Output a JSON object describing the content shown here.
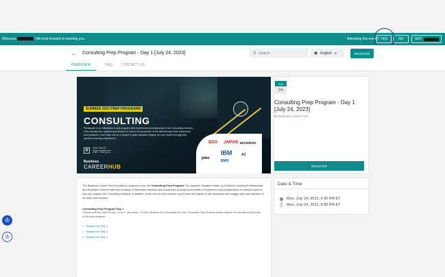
{
  "banner": {
    "welcome_prefix": "Welcome",
    "welcome_suffix": "! We look forward to meeting you.",
    "attend_question": "Attending this event?",
    "yes": "YES",
    "no": "NO",
    "not_sure": "NOT"
  },
  "header": {
    "back_icon": "arrow-left-icon",
    "title": "Consulting Prep Program - Day 1 [July 24, 2023]",
    "search_placeholder": "Search",
    "language": "English",
    "register": "REGISTER",
    "tabs": [
      "OVERVIEW",
      "FAQ",
      "CONTACT US"
    ]
  },
  "hero": {
    "tag": "SUMMER 2023 PREP PROGRAMS",
    "headline": "CONSULTING",
    "description": "Participate in an interactive 4-day program with experienced professionals in the Consulting industry. Hear directly from experts and alumni on how to be successful in the field through their experience and practices. Don't miss out on a chance to gain valuable insights for your career through this dynamic learning experience!",
    "date_line": "JULY 24-27",
    "time_line": "4:30 - 9:00 p.m.",
    "brand_small": "Business",
    "brand_main": "CAREER",
    "brand_accent": "HUB",
    "logos": [
      "BDO",
      "JARVIS",
      "accenture",
      "pwc",
      "IBM",
      "BMO",
      "AC"
    ]
  },
  "info": {
    "month": "JUL",
    "day": "24",
    "title": "Consulting Prep Program - Day 1 [July 24, 2023]",
    "by": "By Business Career Hub",
    "register": "REGISTER"
  },
  "description": {
    "intro_1": "The Business Career Hub is excited to present to you, the ",
    "intro_bold": "Consulting Prep Program",
    "intro_2": "! Our dynamic Speakers made up of Alumni, Industry Professionals, and Employer Partners will lead a variety of interactive sessions and workshops to share their wealth of experience and perspectives on various topics to help you explore the Consulting Industry! In addition, at the end of each session, you'll have the chance to ask questions and engage with each speaker in an open Q&A session.",
    "heading": "Consulting Prep Program Day 1",
    "note": "*Please note this event is Day 1 of a 4- Day series. To fully maximize the knowledge from the Consulting Prep Program please register for and attend every day of this prep program*",
    "links": [
      "Register for Day 2",
      "Register for Day 3",
      "Register for Day 4"
    ]
  },
  "datetime": {
    "heading": "Date & Time",
    "start": "Mon, July 24, 2023, 5:30 PM ET",
    "end": "Mon, July 24, 2023, 9:00 PM ET"
  },
  "accessibility": {
    "icon_1": "accessibility-person-icon",
    "icon_2": "accessibility-alt-icon"
  },
  "colors": {
    "accent": "#0e8c8c",
    "a11y": "#1b4fb8"
  }
}
